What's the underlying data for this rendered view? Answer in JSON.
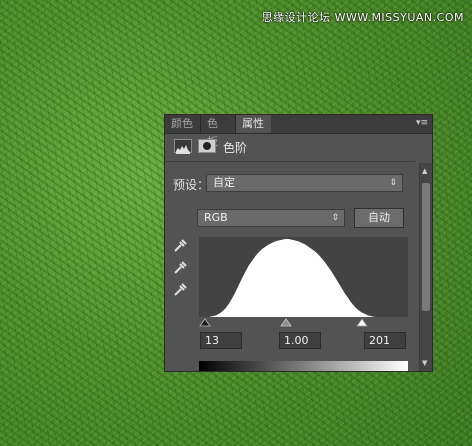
{
  "watermark": "思缘设计论坛 WWW.MISSYUAN.COM",
  "tabs": [
    "颜色",
    "色板",
    "属性"
  ],
  "active_tab": "属性",
  "panel_title": "色阶",
  "preset": {
    "label": "预设：",
    "value": "自定"
  },
  "channel": {
    "value": "RGB"
  },
  "auto_button": "自动",
  "inputs": {
    "black": "13",
    "gamma": "1.00",
    "white": "201"
  },
  "histogram": [
    0,
    0,
    0,
    0,
    0.01,
    0.02,
    0.04,
    0.07,
    0.11,
    0.17,
    0.24,
    0.32,
    0.41,
    0.5,
    0.58,
    0.66,
    0.72,
    0.78,
    0.83,
    0.87,
    0.9,
    0.93,
    0.95,
    0.97,
    0.98,
    0.99,
    1,
    1,
    0.99,
    0.98,
    0.97,
    0.95,
    0.93,
    0.9,
    0.87,
    0.84,
    0.8,
    0.75,
    0.7,
    0.64,
    0.58,
    0.51,
    0.44,
    0.37,
    0.3,
    0.24,
    0.18,
    0.13,
    0.09,
    0.06,
    0.04,
    0.02,
    0.01,
    0,
    0,
    0,
    0,
    0,
    0,
    0,
    0,
    0,
    0,
    0
  ],
  "colors": {
    "panel_bg": "#535353",
    "tabbar_bg": "#3c3c3c",
    "histogram_bg": "#434343",
    "histogram_fill": "#ffffff"
  },
  "icons": [
    "levels-icon",
    "mask-icon",
    "panel-menu-icon",
    "eyedropper-black-icon",
    "eyedropper-gray-icon",
    "eyedropper-white-icon"
  ]
}
